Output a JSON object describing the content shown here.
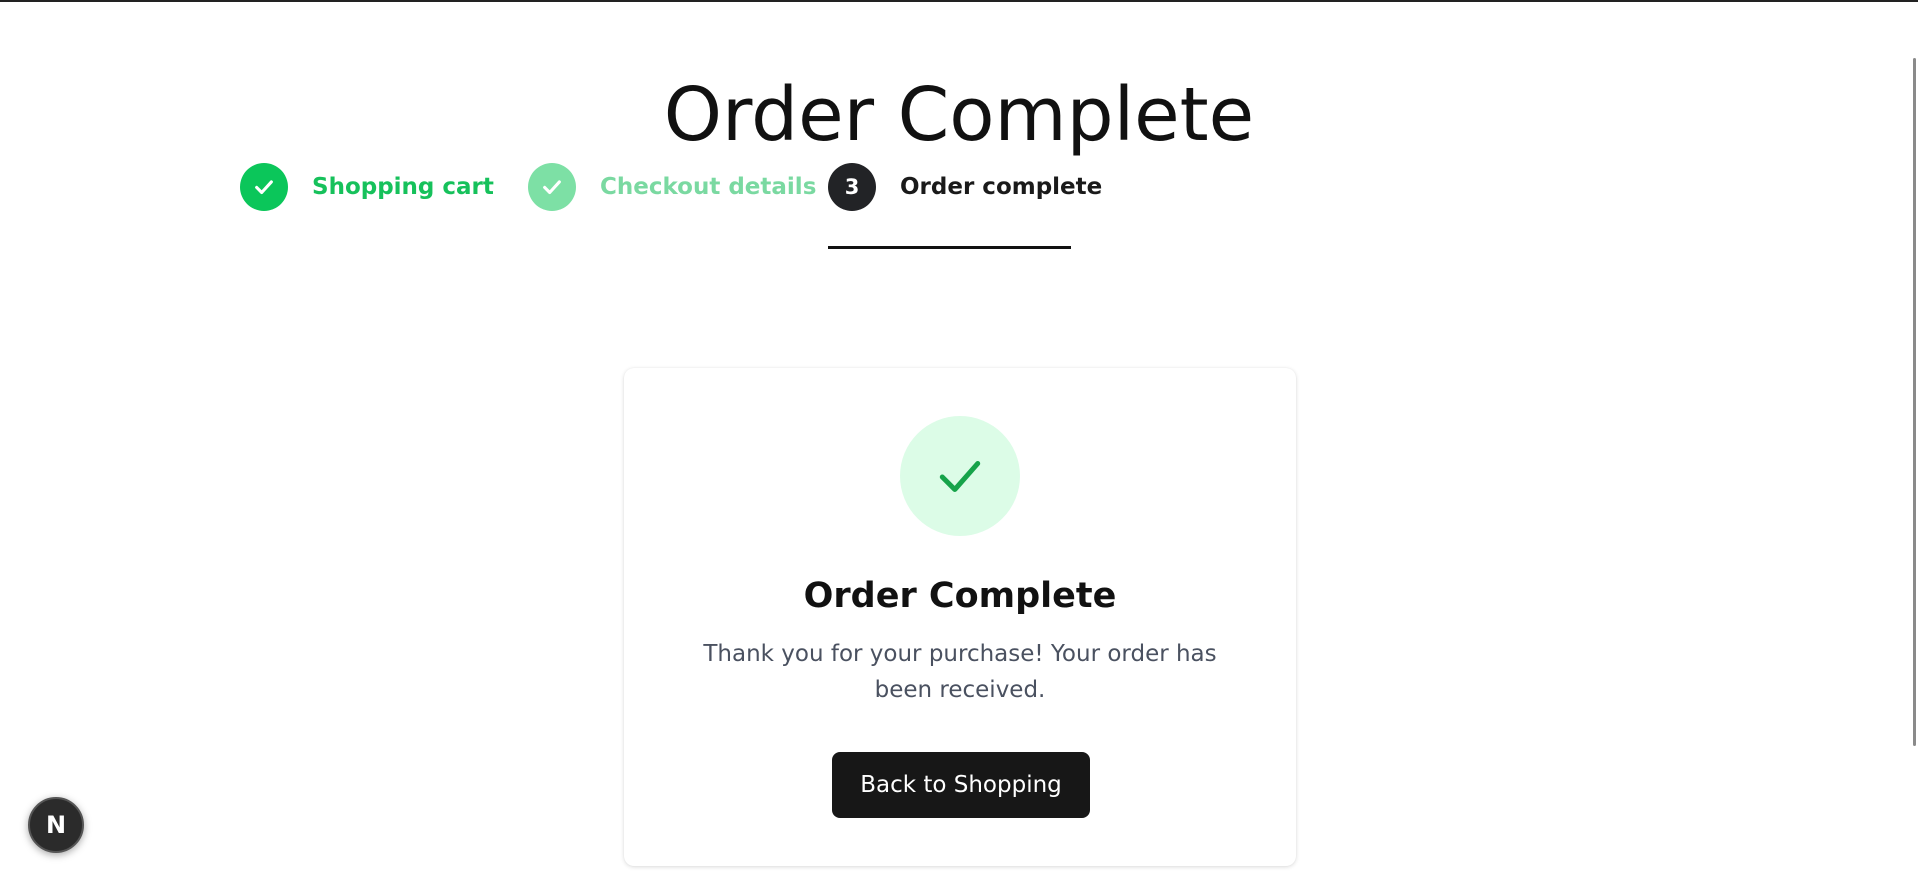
{
  "page": {
    "title": "Order Complete"
  },
  "stepper": {
    "steps": [
      {
        "label": "Shopping cart",
        "state": "completed",
        "icon": "check-icon"
      },
      {
        "label": "Checkout details",
        "state": "completed",
        "icon": "check-icon"
      },
      {
        "label": "Order complete",
        "state": "active",
        "number": "3"
      }
    ]
  },
  "card": {
    "icon": "check-icon",
    "title": "Order Complete",
    "message": "Thank you for your purchase! Your order has been received.",
    "button_label": "Back to Shopping"
  },
  "dev_badge": {
    "label": "N"
  },
  "colors": {
    "success": "#0bc65a",
    "success_light": "#7de0a5",
    "success_bg": "#dcfce7",
    "check_dark": "#16a34a",
    "active_step": "#222326",
    "button_bg": "#171717"
  }
}
